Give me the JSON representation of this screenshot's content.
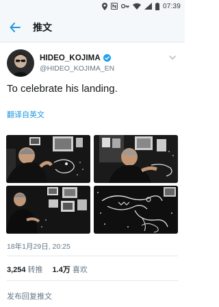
{
  "status_bar": {
    "time": "07:39",
    "icons": [
      "location-icon",
      "nfc-icon",
      "key-icon",
      "wifi-icon",
      "signal-icon",
      "battery-icon"
    ]
  },
  "app_bar": {
    "back_icon": "arrow-left-icon",
    "title": "推文"
  },
  "author": {
    "display_name": "HIDEO_KOJIMA",
    "handle": "@HIDEO_KOJIMA_EN",
    "verified_icon": "verified-badge-icon",
    "more_icon": "chevron-down-icon"
  },
  "tweet": {
    "text": "To celebrate his landing.",
    "translate_label": "翻译自英文",
    "media_count": 4,
    "timestamp": "18年1月29日, 20:25"
  },
  "stats": {
    "retweets_count": "3,254",
    "retweets_label": "转推",
    "likes_count": "1.4万",
    "likes_label": "喜欢"
  },
  "reply": {
    "placeholder": "发布回复推文"
  },
  "colors": {
    "accent": "#1b95e0",
    "verified": "#1da1f2",
    "text_primary": "#14171a",
    "text_secondary": "#657786",
    "divider": "#e1e8ed",
    "bar_bg": "#f5f8fa"
  }
}
